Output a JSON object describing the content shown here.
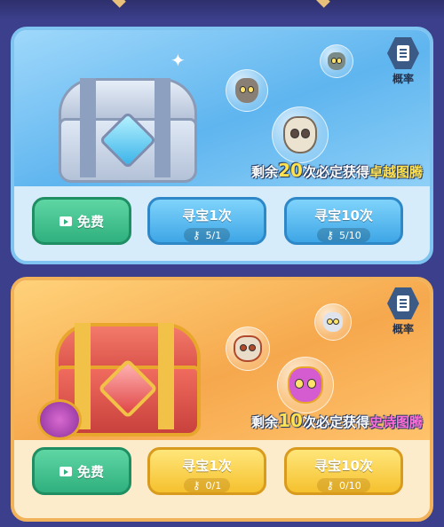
{
  "boxes": [
    {
      "theme": "blue",
      "rate_label": "概率",
      "promo": {
        "prefix": "剩余",
        "count": "20",
        "middle": "次必定获得",
        "reward": "卓越图腾"
      },
      "free_label": "免费",
      "draw_once": {
        "label": "寻宝1次",
        "cost_icon": "key-icon",
        "cost": "5/1"
      },
      "draw_ten": {
        "label": "寻宝10次",
        "cost_icon": "key-icon",
        "cost": "5/10"
      }
    },
    {
      "theme": "gold",
      "rate_label": "概率",
      "promo": {
        "prefix": "剩余",
        "count": "10",
        "middle": "次必定获得",
        "reward": "史诗图腾"
      },
      "free_label": "免费",
      "draw_once": {
        "label": "寻宝1次",
        "cost_icon": "key-icon",
        "cost": "0/1"
      },
      "draw_ten": {
        "label": "寻宝10次",
        "cost_icon": "key-icon",
        "cost": "0/10"
      }
    }
  ],
  "colors": {
    "free_green": "#2fb07e",
    "draw_blue": "#3ea6e6",
    "draw_yellow": "#f5c12e",
    "promo_yellow": "#ffe24d",
    "promo_pink": "#ff6ed8"
  }
}
